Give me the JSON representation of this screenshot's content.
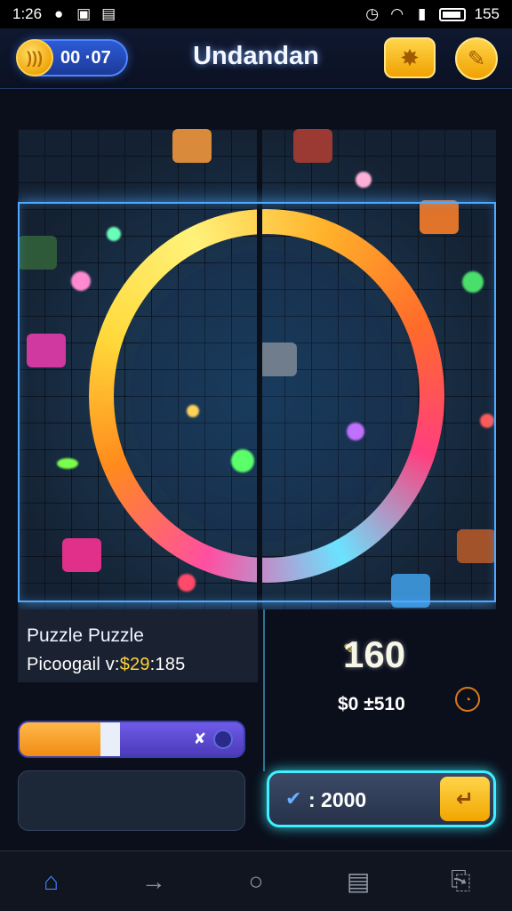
{
  "status_bar": {
    "time": "1:26",
    "battery": "155"
  },
  "header": {
    "coin_amount": "00 ·07",
    "title": "Undandan",
    "settings_icon": "gear-icon",
    "edit_icon": "pencil-icon"
  },
  "puzzle": {
    "name": "Puzzle Puzzle",
    "meta_prefix": "Picoogail v:",
    "meta_highlight": "$29",
    "meta_suffix": ":185"
  },
  "score": {
    "main": "160",
    "secondary": "$0 ±510"
  },
  "progress": {
    "fraction": 0.36,
    "marker": "✘"
  },
  "reward": {
    "value": ": 2000"
  },
  "nav": {
    "items": [
      "home-icon",
      "arrow-right-icon",
      "circle-icon",
      "inbox-icon",
      "profile-icon"
    ]
  },
  "colors": {
    "accent": "#3f86ff",
    "gold": "#f0a100",
    "glow": "#3ff0ff"
  }
}
